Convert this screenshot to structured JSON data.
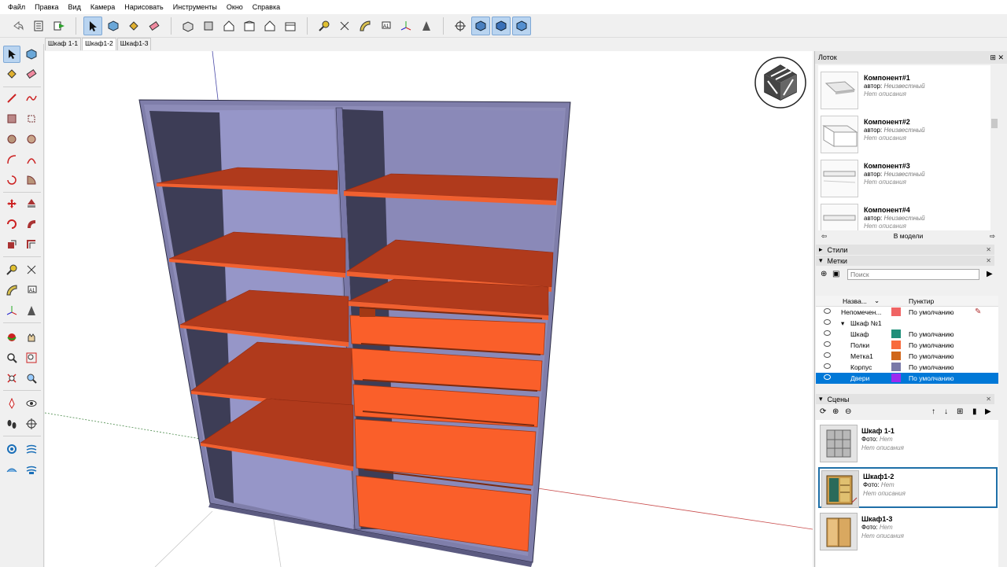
{
  "menu": [
    "Файл",
    "Правка",
    "Вид",
    "Камера",
    "Нарисовать",
    "Инструменты",
    "Окно",
    "Справка"
  ],
  "tabs": [
    "Шкаф 1-1",
    "Шкаф1-2",
    "Шкаф1-3"
  ],
  "tray": {
    "title": "Лоток",
    "components": [
      {
        "name": "Компонент#1",
        "author_label": "автор:",
        "author": "Неизвестный",
        "desc": "Нет описания"
      },
      {
        "name": "Компонент#2",
        "author_label": "автор:",
        "author": "Неизвестный",
        "desc": "Нет описания"
      },
      {
        "name": "Компонент#3",
        "author_label": "автор:",
        "author": "Неизвестный",
        "desc": "Нет описания"
      },
      {
        "name": "Компонент#4",
        "author_label": "автор:",
        "author": "Неизвестный",
        "desc": "Нет описания"
      }
    ],
    "in_model": "В модели",
    "styles_label": "Стили",
    "tags_label": "Метки",
    "search_placeholder": "Поиск",
    "tag_col_name": "Назва...",
    "tag_col_dash": "Пунктир",
    "tags": [
      {
        "name": "Непомечен...",
        "color": "#f06464",
        "dash": "По умолчанию",
        "indent": 0
      },
      {
        "name": "Шкаф №1",
        "color": "",
        "dash": "",
        "indent": 1
      },
      {
        "name": "Шкаф",
        "color": "#1f8f7a",
        "dash": "По умолчанию",
        "indent": 2
      },
      {
        "name": "Полки",
        "color": "#f86a3c",
        "dash": "По умолчанию",
        "indent": 2
      },
      {
        "name": "Метка1",
        "color": "#d0661a",
        "dash": "По умолчанию",
        "indent": 2
      },
      {
        "name": "Корпус",
        "color": "#7a79a8",
        "dash": "По умолчанию",
        "indent": 2
      },
      {
        "name": "Двери",
        "color": "#9c2bf0",
        "dash": "По умолчанию",
        "indent": 2,
        "selected": true
      }
    ],
    "scenes_label": "Сцены",
    "scenes": [
      {
        "name": "Шкаф 1-1",
        "photo_label": "Фото:",
        "photo": "Нет",
        "desc": "Нет описания"
      },
      {
        "name": "Шкаф1-2",
        "photo_label": "Фото:",
        "photo": "Нет",
        "desc": "Нет описания",
        "selected": true
      },
      {
        "name": "Шкаф1-3",
        "photo_label": "Фото:",
        "photo": "Нет",
        "desc": "Нет описания"
      }
    ]
  },
  "colors": {
    "shelf": "#b03a1c",
    "shelf_edge": "#f06030",
    "drawer": "#fa5f2a",
    "carcass": "#7f7eaa",
    "carcass_dark": "#3f3f58",
    "selection": "#0078d7"
  }
}
